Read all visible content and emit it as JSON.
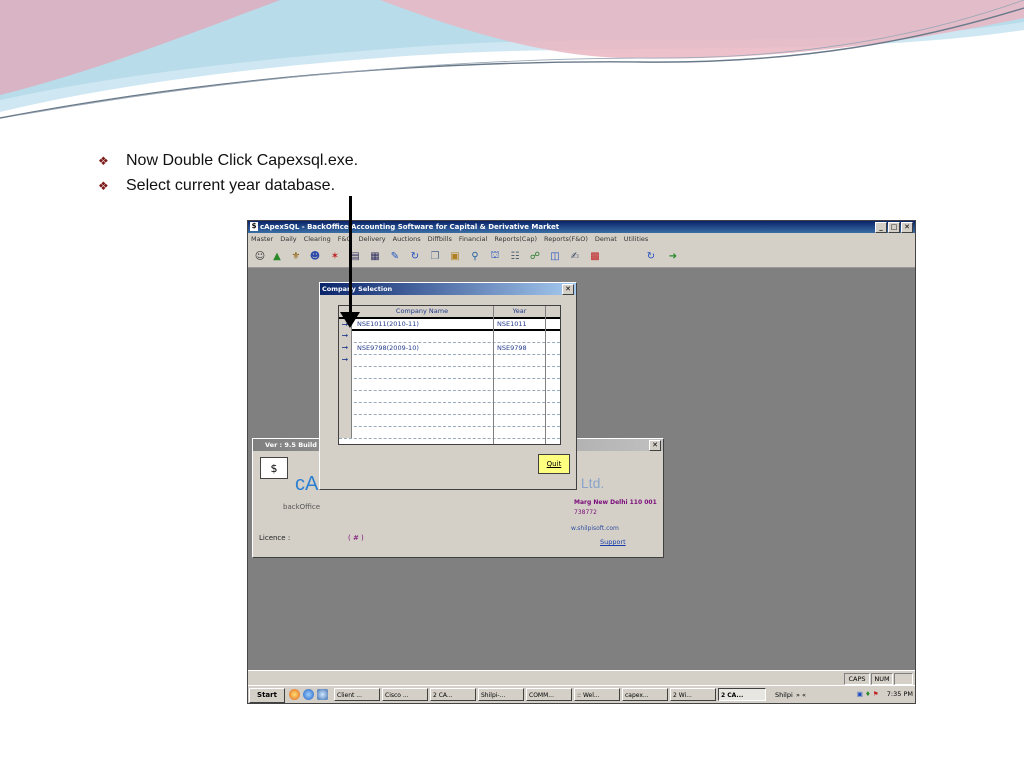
{
  "bullets": [
    "Now Double Click Capexsql.exe.",
    "Select current year database."
  ],
  "app": {
    "title": "cApexSQL - BackOffice Accounting Software for Capital & Derivative Market",
    "menu": [
      "Master",
      "Daily",
      "Clearing",
      "F&O",
      "Delivery",
      "Auctions",
      "Diffbills",
      "Financial",
      "Reports(Cap)",
      "Reports(F&O)",
      "Demat",
      "Utilities"
    ],
    "win_buttons": [
      "_",
      "□",
      "✕"
    ]
  },
  "about": {
    "title": "Ver : 9.5 Build",
    "logo_text": "cA",
    "backoffice": "backOffice",
    "licence_label": "Licence :",
    "licence_value": "( # )",
    "ltd_text": "s Ltd.",
    "address": "Marg New Delhi 110 001",
    "phone": "738772",
    "website": "w.shilpisoft.com",
    "support": "Support",
    "close": "✕"
  },
  "dialog": {
    "title": "Company Selection",
    "close": "✕",
    "columns": [
      "Company Name",
      "Year"
    ],
    "rows": [
      {
        "name": "NSE1011(2010-11)",
        "year": "NSE1011"
      },
      {
        "name": "",
        "year": ""
      },
      {
        "name": "NSE9798(2009-10)",
        "year": "NSE9798"
      },
      {
        "name": "",
        "year": ""
      }
    ],
    "quit_label": "Quit"
  },
  "status": {
    "caps": "CAPS",
    "num": "NUM"
  },
  "taskbar": {
    "start": "Start",
    "buttons": [
      "Client ...",
      "Cisco ...",
      "2 CA...",
      "Shilpi-...",
      "COMM...",
      ":: Wel...",
      "capex...",
      "2 Wi...",
      "2 CA..."
    ],
    "tray_label": "Shilpi",
    "chevrons": "» «",
    "clock": "7:35 PM"
  },
  "colors": {
    "accent": "#0a246a",
    "window_bg": "#d4d0c8",
    "desktop": "#808080",
    "grid_text": "#223a8a"
  }
}
